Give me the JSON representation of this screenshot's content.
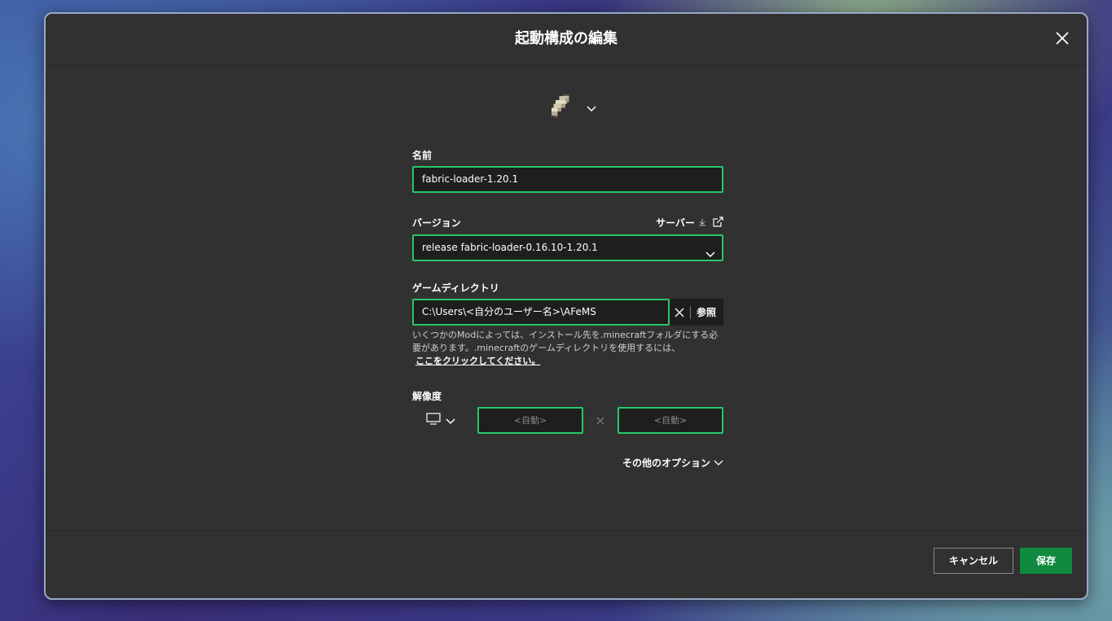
{
  "dialog": {
    "title": "起動構成の編集"
  },
  "icon": {
    "name": "bed-item-icon"
  },
  "name_field": {
    "label": "名前",
    "value": "fabric-loader-1.20.1"
  },
  "version_field": {
    "label": "バージョン",
    "server_link": "サーバー",
    "selected": "release fabric-loader-0.16.10-1.20.1"
  },
  "game_dir": {
    "label": "ゲームディレクトリ",
    "value": "C:\\Users\\<自分のユーザー名>\\AFeMS",
    "browse_label": "参照",
    "hint_line1": "いくつかのModによっては、インストール先を.minecraftフォルダにする必",
    "hint_line2": "要があります。.minecraftのゲームディレクトリを使用するには、",
    "hint_link": "ここをクリックしてください。"
  },
  "resolution": {
    "label": "解像度",
    "width_placeholder": "<自動>",
    "height_placeholder": "<自動>",
    "separator": "×"
  },
  "more_options": "その他のオプション",
  "footer": {
    "cancel_label": "キャンセル",
    "save_label": "保存"
  },
  "colors": {
    "accent_green": "#27c76a",
    "save_green": "#0f8a3f",
    "panel_bg": "#313131",
    "input_bg": "#1e1e1e"
  }
}
